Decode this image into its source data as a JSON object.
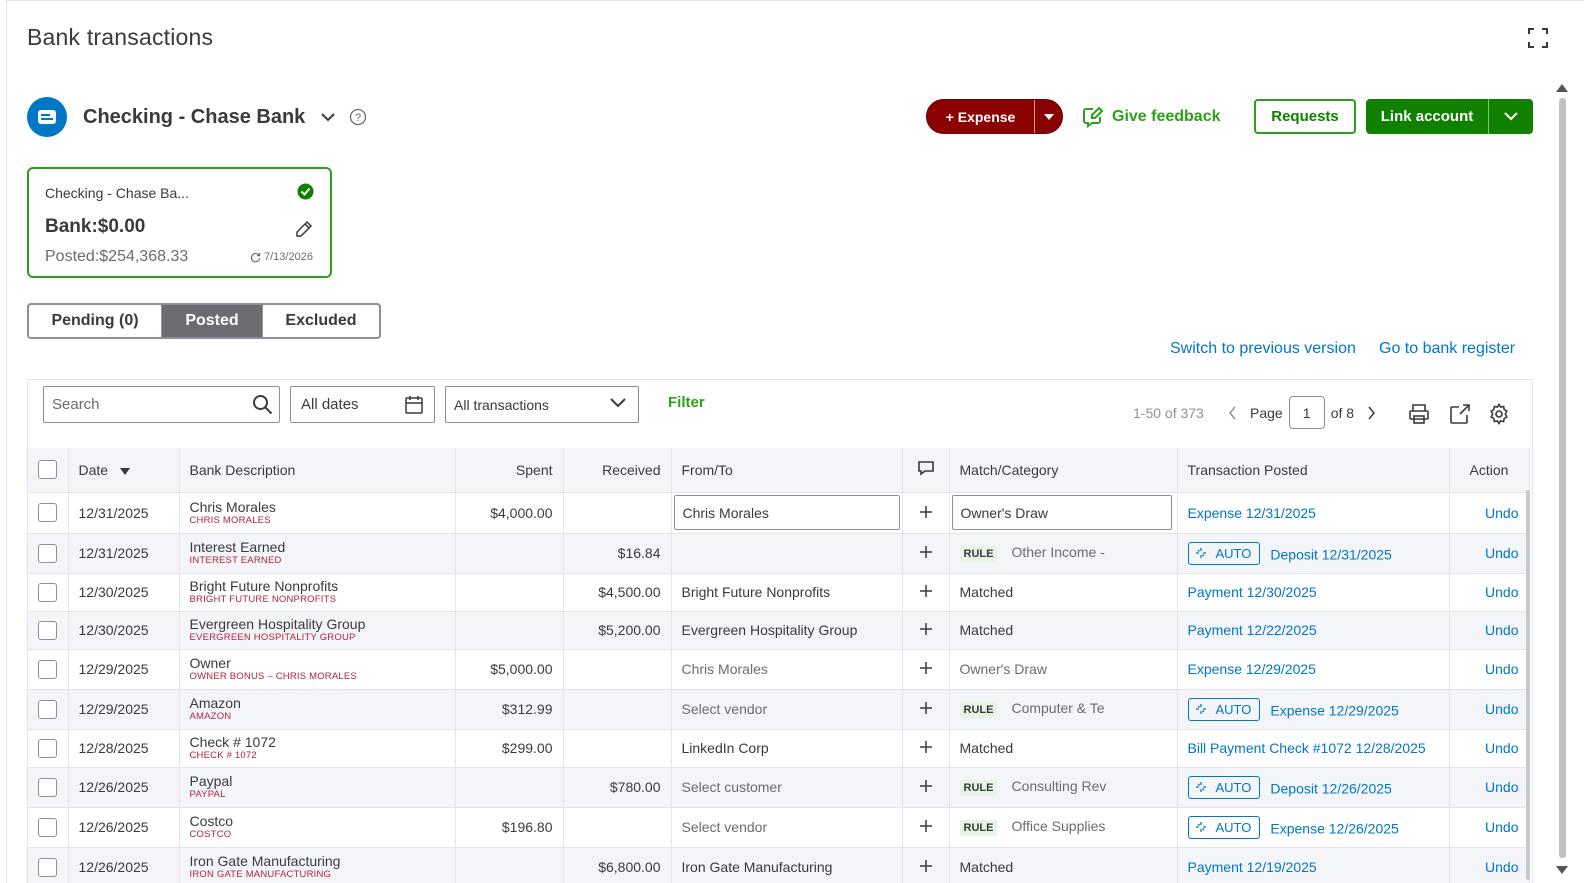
{
  "page": {
    "title": "Bank transactions"
  },
  "account": {
    "name": "Checking - Chase Bank"
  },
  "toolbar": {
    "expense_label": "+ Expense",
    "feedback_label": "Give feedback",
    "requests_label": "Requests",
    "link_account_label": "Link account"
  },
  "card": {
    "name": "Checking - Chase Ba...",
    "bank_label": "Bank:",
    "bank_value": "$0.00",
    "posted_label": "Posted:",
    "posted_value": "$254,368.33",
    "sync_date": "7/13/2026"
  },
  "tabs": [
    {
      "label": "Pending (0)",
      "active": false
    },
    {
      "label": "Posted",
      "active": true
    },
    {
      "label": "Excluded",
      "active": false
    }
  ],
  "links": {
    "switch_prev": "Switch to previous version",
    "bank_register": "Go to bank register"
  },
  "filters": {
    "search_placeholder": "Search",
    "dates": "All dates",
    "transactions": "All transactions",
    "filter_label": "Filter"
  },
  "pagination": {
    "range": "1-50 of 373",
    "page_label": "Page",
    "page": "1",
    "of_label": "of 8"
  },
  "columns": {
    "date": "Date",
    "bank_description": "Bank Description",
    "spent": "Spent",
    "received": "Received",
    "from_to": "From/To",
    "match_category": "Match/Category",
    "transaction_posted": "Transaction Posted",
    "action": "Action"
  },
  "rows": [
    {
      "date": "12/31/2025",
      "desc": "Chris Morales",
      "desc_sub": "CHRIS MORALES",
      "spent": "$4,000.00",
      "received": "",
      "from_to": "Chris Morales",
      "category": "Owner's Draw",
      "posted": "Expense 12/31/2025",
      "action": "Undo"
    },
    {
      "date": "12/31/2025",
      "desc": "Interest Earned",
      "desc_sub": "INTEREST EARNED",
      "spent": "",
      "received": "$16.84",
      "from_to": "",
      "rule": "RULE",
      "category": "Other Income -",
      "auto": "AUTO",
      "posted": "Deposit 12/31/2025",
      "action": "Undo"
    },
    {
      "date": "12/30/2025",
      "desc": "Bright Future Nonprofits",
      "desc_sub": "BRIGHT FUTURE NONPROFITS",
      "spent": "",
      "received": "$4,500.00",
      "from_to": "Bright Future Nonprofits",
      "category": "Matched",
      "posted": "Payment 12/30/2025",
      "action": "Undo"
    },
    {
      "date": "12/30/2025",
      "desc": "Evergreen Hospitality Group",
      "desc_sub": "EVERGREEN HOSPITALITY GROUP",
      "spent": "",
      "received": "$5,200.00",
      "from_to": "Evergreen Hospitality Group",
      "category": "Matched",
      "posted": "Payment 12/22/2025",
      "action": "Undo"
    },
    {
      "date": "12/29/2025",
      "desc": "Owner",
      "desc_sub": "OWNER BONUS – CHRIS MORALES",
      "spent": "$5,000.00",
      "received": "",
      "from_to": "Chris Morales",
      "category": "Owner's Draw",
      "posted": "Expense 12/29/2025",
      "action": "Undo"
    },
    {
      "date": "12/29/2025",
      "desc": "Amazon",
      "desc_sub": "AMAZON",
      "spent": "$312.99",
      "received": "",
      "from_to": "Select vendor",
      "rule": "RULE",
      "category": "Computer & Te",
      "auto": "AUTO",
      "posted": "Expense 12/29/2025",
      "action": "Undo"
    },
    {
      "date": "12/28/2025",
      "desc": "Check # 1072",
      "desc_sub": "CHECK # 1072",
      "spent": "$299.00",
      "received": "",
      "from_to": "LinkedIn Corp",
      "category": "Matched",
      "posted": "Bill Payment Check #1072 12/28/2025",
      "action": "Undo"
    },
    {
      "date": "12/26/2025",
      "desc": "Paypal",
      "desc_sub": "PAYPAL",
      "spent": "",
      "received": "$780.00",
      "from_to": "Select customer",
      "rule": "RULE",
      "category": "Consulting Rev",
      "auto": "AUTO",
      "posted": "Deposit 12/26/2025",
      "action": "Undo"
    },
    {
      "date": "12/26/2025",
      "desc": "Costco",
      "desc_sub": "COSTCO",
      "spent": "$196.80",
      "received": "",
      "from_to": "Select vendor",
      "rule": "RULE",
      "category": "Office Supplies",
      "auto": "AUTO",
      "posted": "Expense 12/26/2025",
      "action": "Undo"
    },
    {
      "date": "12/26/2025",
      "desc": "Iron Gate Manufacturing",
      "desc_sub": "IRON GATE MANUFACTURING",
      "spent": "",
      "received": "$6,800.00",
      "from_to": "Iron Gate Manufacturing",
      "category": "Matched",
      "posted": "Payment 12/19/2025",
      "action": "Undo"
    }
  ]
}
